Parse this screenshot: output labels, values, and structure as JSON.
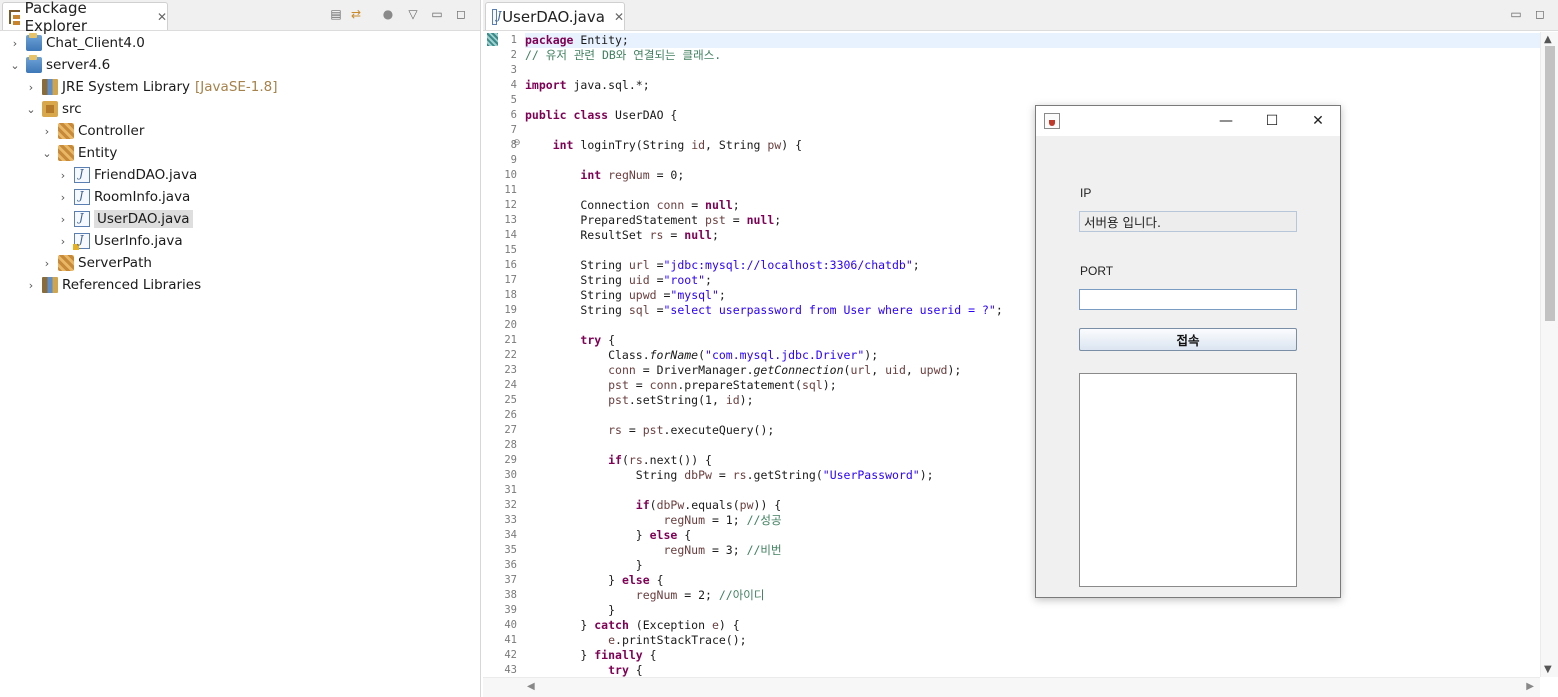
{
  "package_explorer": {
    "tab_title": "Package Explorer",
    "tree": [
      {
        "label": "Chat_Client4.0",
        "level": 0,
        "expanded": false,
        "icon": "project-icon"
      },
      {
        "label": "server4.6",
        "level": 0,
        "expanded": true,
        "icon": "project-icon"
      },
      {
        "label": "JRE System Library",
        "meta": "[JavaSE-1.8]",
        "level": 1,
        "expanded": false,
        "icon": "library-icon"
      },
      {
        "label": "src",
        "level": 1,
        "expanded": true,
        "icon": "source-folder-icon"
      },
      {
        "label": "Controller",
        "level": 2,
        "expanded": false,
        "icon": "package-icon"
      },
      {
        "label": "Entity",
        "level": 2,
        "expanded": true,
        "icon": "package-icon"
      },
      {
        "label": "FriendDAO.java",
        "level": 3,
        "expanded": false,
        "icon": "java-file-icon"
      },
      {
        "label": "RoomInfo.java",
        "level": 3,
        "expanded": false,
        "icon": "java-file-icon"
      },
      {
        "label": "UserDAO.java",
        "level": 3,
        "expanded": false,
        "icon": "java-file-icon",
        "selected": true
      },
      {
        "label": "UserInfo.java",
        "level": 3,
        "expanded": false,
        "icon": "java-file-icon",
        "warning": true
      },
      {
        "label": "ServerPath",
        "level": 2,
        "expanded": false,
        "icon": "package-icon"
      },
      {
        "label": "Referenced Libraries",
        "level": 1,
        "expanded": false,
        "icon": "library-icon"
      }
    ]
  },
  "editor": {
    "tab_title": "UserDAO.java",
    "code_lines": [
      "<span class=\"kw\">package</span> Entity;",
      "<span class=\"cmt\">// 유저 관련 DB와 연결되는 클래스.</span>",
      "",
      "<span class=\"kw\">import</span> java.sql.*;",
      "",
      "<span class=\"kw\">public</span> <span class=\"kw\">class</span> UserDAO {",
      "",
      "    <span class=\"kw\">int</span> loginTry(String <span class=\"var\">id</span>, String <span class=\"var\">pw</span>) {",
      "",
      "        <span class=\"kw\">int</span> <span class=\"var\">regNum</span> = 0;",
      "",
      "        Connection <span class=\"var\">conn</span> = <span class=\"kw\">null</span>;",
      "        PreparedStatement <span class=\"var\">pst</span> = <span class=\"kw\">null</span>;",
      "        ResultSet <span class=\"var\">rs</span> = <span class=\"kw\">null</span>;",
      "",
      "        String <span class=\"var\">url</span> =<span class=\"str\">\"jdbc:mysql://localhost:3306/chatdb\"</span>;",
      "        String <span class=\"var\">uid</span> =<span class=\"str\">\"root\"</span>;",
      "        String <span class=\"var\">upwd</span> =<span class=\"str\">\"mysql\"</span>;",
      "        String <span class=\"var\">sql</span> =<span class=\"str\">\"select userpassword from User where userid = ?\"</span>;",
      "",
      "        <span class=\"kw\">try</span> {",
      "            Class.<span class=\"it\">forName</span>(<span class=\"str\">\"com.mysql.jdbc.Driver\"</span>);",
      "            <span class=\"var\">conn</span> = DriverManager.<span class=\"it\">getConnection</span>(<span class=\"var\">url</span>, <span class=\"var\">uid</span>, <span class=\"var\">upwd</span>);",
      "            <span class=\"var\">pst</span> = <span class=\"var\">conn</span>.prepareStatement(<span class=\"var\">sql</span>);",
      "            <span class=\"var\">pst</span>.setString(1, <span class=\"var\">id</span>);",
      "",
      "            <span class=\"var\">rs</span> = <span class=\"var\">pst</span>.executeQuery();",
      "",
      "            <span class=\"kw\">if</span>(<span class=\"var\">rs</span>.next()) {",
      "                String <span class=\"var\">dbPw</span> = <span class=\"var\">rs</span>.getString(<span class=\"str\">\"UserPassword\"</span>);",
      "",
      "                <span class=\"kw\">if</span>(<span class=\"var\">dbPw</span>.equals(<span class=\"var\">pw</span>)) {",
      "                    <span class=\"var\">regNum</span> = 1; <span class=\"cmt\">//성공</span>",
      "                } <span class=\"kw\">else</span> {",
      "                    <span class=\"var\">regNum</span> = 3; <span class=\"cmt\">//비번</span>",
      "                }",
      "            } <span class=\"kw\">else</span> {",
      "                <span class=\"var\">regNum</span> = 2; <span class=\"cmt\">//아이디</span>",
      "            }",
      "        } <span class=\"kw\">catch</span> (Exception <span class=\"var\">e</span>) {",
      "            <span class=\"var\">e</span>.printStackTrace();",
      "        } <span class=\"kw\">finally</span> {",
      "            <span class=\"kw\">try</span> {"
    ]
  },
  "dialog": {
    "ip_label": "IP",
    "ip_value": "서버용 입니다.",
    "port_label": "PORT",
    "port_value": "",
    "connect_label": "접속",
    "log_text": "",
    "buttons": {
      "minimize": "—",
      "maximize": "☐",
      "close": "✕"
    }
  }
}
